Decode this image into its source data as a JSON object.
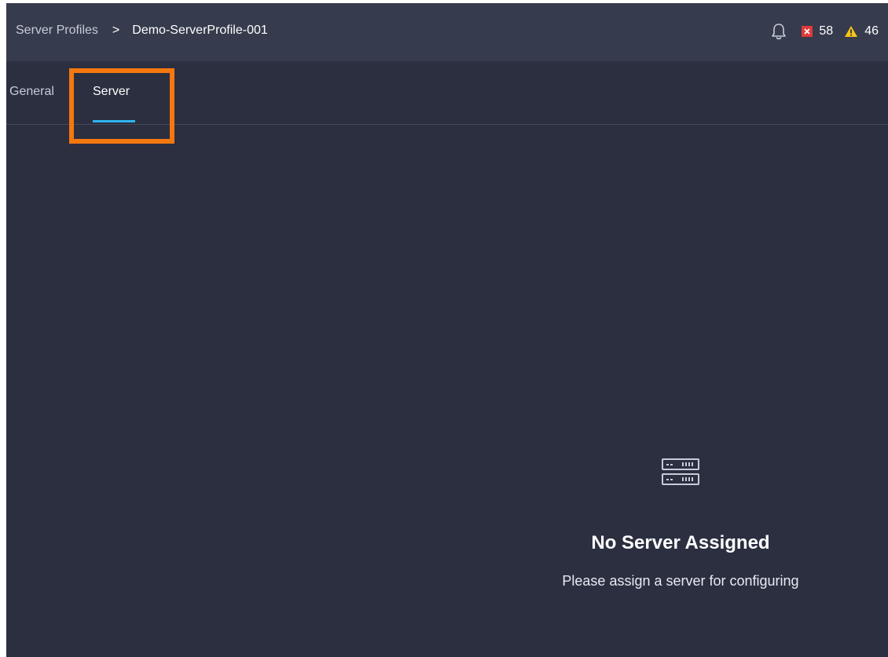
{
  "breadcrumb": {
    "parent": "Server Profiles",
    "separator": ">",
    "current": "Demo-ServerProfile-001"
  },
  "alerts": {
    "critical_count": "58",
    "warning_count": "46",
    "critical_color": "#e03a3a",
    "warning_color": "#f5c518"
  },
  "tabs": [
    {
      "label": "General",
      "active": false
    },
    {
      "label": "Server",
      "active": true
    }
  ],
  "tab_accent_color": "#2fb4f5",
  "highlight_color": "#f5780f",
  "empty_state": {
    "icon": "server-icon",
    "title": "No Server Assigned",
    "subtitle": "Please assign a server for configuring"
  }
}
